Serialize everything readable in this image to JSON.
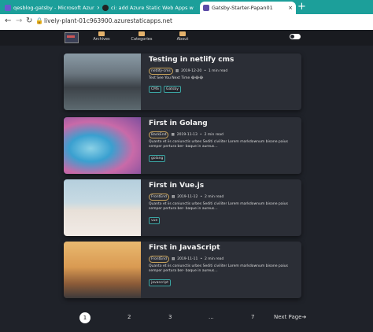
{
  "browser": {
    "tabs": [
      {
        "label": "qesblog-gatsby - Microsoft Azur",
        "fav_color": "#6a5acd"
      },
      {
        "label": "ci: add Azure Static Web Apps w",
        "fav_color": "#222222"
      },
      {
        "label": "Gatsby-Starter-Papan01",
        "fav_color": "#5c4ba8"
      }
    ],
    "close_glyph": "×",
    "newtab_glyph": "+",
    "url": "lively-plant-01c963900.azurestaticapps.net"
  },
  "site_nav": {
    "items": [
      {
        "label": "Archives",
        "icon": "book-icon"
      },
      {
        "label": "Categories",
        "icon": "folder-icon"
      },
      {
        "label": "About",
        "icon": "person-icon"
      }
    ]
  },
  "posts": [
    {
      "title": "Testing in netlify cms",
      "category": "netlify-cms",
      "date": "2019-12-20",
      "read": "1 min read",
      "excerpt": "Test See You Next Time 😂😂😂",
      "tags": [
        "CMS",
        "Gatsby"
      ]
    },
    {
      "title": "First in Golang",
      "category": "BackEnd",
      "date": "2019-11-13",
      "read": "2 min read",
      "excerpt": "Quanto et iis coniunctis urbes Sediti civiliter Lorem markdownum bisone paius semper pertura ber- baque in aureus…",
      "tags": [
        "golang"
      ]
    },
    {
      "title": "First in Vue.js",
      "category": "FrontEnd",
      "date": "2019-11-12",
      "read": "2 min read",
      "excerpt": "Quanto et iis coniunctis urbes Sediti civiliter Lorem markdownum bisone paius semper pertura ber- baque in aureus…",
      "tags": [
        "vue"
      ]
    },
    {
      "title": "First in JavaScript",
      "category": "FrontEnd",
      "date": "2019-11-11",
      "read": "2 min read",
      "excerpt": "Quanto et iis coniunctis urbes Sediti civiliter Lorem markdownum bisone paius semper pertura ber- baque in aureus…",
      "tags": [
        "javascript"
      ]
    }
  ],
  "pagination": {
    "current": "1",
    "pages": [
      "2",
      "3",
      "...",
      "7"
    ],
    "next": "Next Page"
  }
}
